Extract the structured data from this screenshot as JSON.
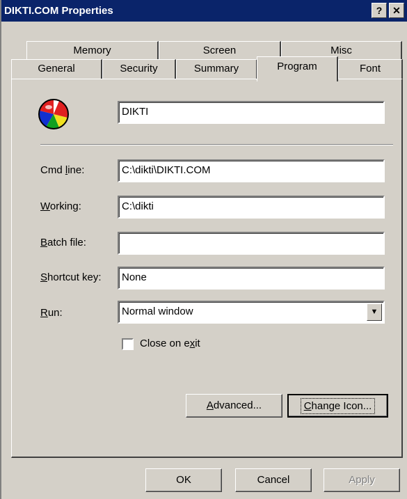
{
  "window": {
    "title": "DIKTI.COM Properties",
    "help_glyph": "?",
    "close_glyph": "✕"
  },
  "tabs": {
    "back_row": [
      "Memory",
      "Screen",
      "Misc"
    ],
    "front_row": [
      "General",
      "Security",
      "Summary",
      "Program",
      "Font"
    ],
    "active": "Program"
  },
  "program": {
    "icon": "beach-ball-icon",
    "name_value": "DIKTI",
    "cmd_line_label_pre": "Cmd ",
    "cmd_line_label_u": "l",
    "cmd_line_label_post": "ine:",
    "cmd_line_value": "C:\\dikti\\DIKTI.COM",
    "working_label_u": "W",
    "working_label_post": "orking:",
    "working_value": "C:\\dikti",
    "batch_label_u": "B",
    "batch_label_post": "atch file:",
    "batch_value": "",
    "shortcut_label_u": "S",
    "shortcut_label_post": "hortcut key:",
    "shortcut_value": "None",
    "run_label_u": "R",
    "run_label_post": "un:",
    "run_value": "Normal window",
    "close_on_exit_pre": "Close on e",
    "close_on_exit_u": "x",
    "close_on_exit_post": "it",
    "close_on_exit_checked": false,
    "advanced_u": "A",
    "advanced_post": "dvanced...",
    "change_icon_u": "C",
    "change_icon_post": "hange Icon..."
  },
  "footer": {
    "ok": "OK",
    "cancel": "Cancel",
    "apply": "Apply"
  },
  "colors": {
    "face": "#d4d0c8",
    "titlebar": "#0a246a"
  }
}
